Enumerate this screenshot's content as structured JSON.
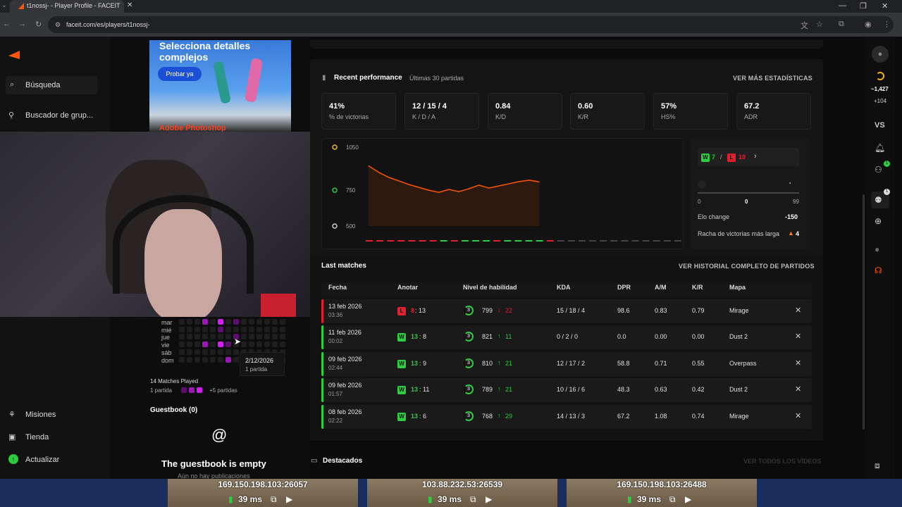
{
  "browser": {
    "tab_title": "t1nossj- - Player Profile - FACEIT",
    "url": "faceit.com/es/players/t1nossj-"
  },
  "sidebar": {
    "search_label": "Búsqueda",
    "group_finder": "Buscador de grup...",
    "missions": "Misiones",
    "store": "Tienda",
    "update": "Actualizar"
  },
  "ad": {
    "headline": "Selecciona detalles complejos",
    "button": "Probar ya",
    "brand": "Adobe Photoshop"
  },
  "activity": {
    "days": [
      "mar",
      "mié",
      "jue",
      "vie",
      "sáb",
      "dom"
    ],
    "tooltip_date": "2/12/2026",
    "tooltip_count": "1 partida",
    "matches_played": "14 Matches Played",
    "legend_min": "1 partida",
    "legend_max": "+5 partidas"
  },
  "guestbook": {
    "title": "Guestbook (0)",
    "empty": "The guestbook is empty",
    "empty_sub": "Aún no hay publicaciones"
  },
  "performance": {
    "title": "Recent performance",
    "subtitle": "Últimas 30 partidas",
    "more_link": "VER MÁS ESTADÍSTICAS",
    "stats": [
      {
        "value": "41%",
        "label": "% de victorias"
      },
      {
        "value": "12 / 15 / 4",
        "label": "K / D / A"
      },
      {
        "value": "0.84",
        "label": "K/D"
      },
      {
        "value": "0.60",
        "label": "K/R"
      },
      {
        "value": "57%",
        "label": "HS%"
      },
      {
        "value": "67.2",
        "label": "ADR"
      }
    ],
    "wins": "7",
    "losses": "10",
    "range_min": "0",
    "range_current": "0",
    "range_max": "99",
    "elo_change_label": "Elo change",
    "elo_change_value": "-150",
    "streak_label": "Racha de victorias más larga",
    "streak_value": "4"
  },
  "chart_data": {
    "type": "area",
    "y_ticks": [
      "1050",
      "750",
      "500"
    ],
    "ylim": [
      500,
      1050
    ],
    "values": [
      920,
      875,
      840,
      815,
      790,
      770,
      750,
      735,
      755,
      740,
      760,
      785,
      765,
      780,
      795,
      810,
      820,
      808
    ],
    "results": [
      "L",
      "L",
      "L",
      "L",
      "L",
      "L",
      "L",
      "W",
      "L",
      "W",
      "W",
      "W",
      "L",
      "W",
      "W",
      "W",
      "W",
      "L",
      "N",
      "N",
      "N",
      "N",
      "N",
      "N",
      "N",
      "N",
      "N",
      "N",
      "N",
      "N"
    ],
    "colors": {
      "line": "#ff5500",
      "win": "#2ecc40",
      "loss": "#e0202e",
      "none": "#444444"
    }
  },
  "matches": {
    "title": "Last matches",
    "history_link": "VER HISTORIAL COMPLETO DE PARTIDOS",
    "headers": [
      "Fecha",
      "Anotar",
      "Nivel de habilidad",
      "KDA",
      "DPR",
      "A/M",
      "K/R",
      "Mapa"
    ],
    "rows": [
      {
        "date": "13 feb 2026",
        "time": "03:36",
        "result": "L",
        "score_a": "8",
        "score_b": "13",
        "level": "3",
        "elo": "799",
        "delta": "22",
        "kda": "15 / 18 / 4",
        "dpr": "98.6",
        "am": "0.83",
        "kr": "0.79",
        "map": "Mirage",
        "win": false
      },
      {
        "date": "11 feb 2026",
        "time": "00:02",
        "result": "W",
        "score_a": "13",
        "score_b": "8",
        "level": "3",
        "elo": "821",
        "delta": "11",
        "kda": "0 / 2 / 0",
        "dpr": "0.0",
        "am": "0.00",
        "kr": "0.00",
        "map": "Dust 2",
        "win": true
      },
      {
        "date": "09 feb 2026",
        "time": "02:44",
        "result": "W",
        "score_a": "13",
        "score_b": "9",
        "level": "3",
        "elo": "810",
        "delta": "21",
        "kda": "12 / 17 / 2",
        "dpr": "58.8",
        "am": "0.71",
        "kr": "0.55",
        "map": "Overpass",
        "win": true
      },
      {
        "date": "09 feb 2026",
        "time": "01:57",
        "result": "W",
        "score_a": "13",
        "score_b": "11",
        "level": "3",
        "elo": "789",
        "delta": "21",
        "kda": "10 / 16 / 6",
        "dpr": "48.3",
        "am": "0.63",
        "kr": "0.42",
        "map": "Dust 2",
        "win": true
      },
      {
        "date": "08 feb 2026",
        "time": "02:22",
        "result": "W",
        "score_a": "13",
        "score_b": "6",
        "level": "3",
        "elo": "768",
        "delta": "29",
        "kda": "14 / 13 / 3",
        "dpr": "67.2",
        "am": "1.08",
        "kr": "0.74",
        "map": "Mirage",
        "win": true
      }
    ]
  },
  "highlights": {
    "title": "Destacados",
    "link": "VER TODOS LOS VÍDEOS"
  },
  "rightbar": {
    "elo": "~1,427",
    "elo_gain": "+104",
    "vs": "VS",
    "badge_friends": "1",
    "badge_party": "1"
  },
  "servers": [
    {
      "ip": "169.150.198.103:26057",
      "ping": "39 ms"
    },
    {
      "ip": "103.88.232.53:26539",
      "ping": "39 ms"
    },
    {
      "ip": "169.150.198.103:26488",
      "ping": "39 ms"
    }
  ]
}
